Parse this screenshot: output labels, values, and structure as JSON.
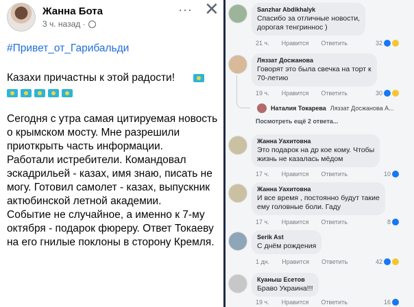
{
  "post": {
    "author": "Жанна Бота",
    "time": "3 ч. назад ·",
    "more": "···",
    "close": "✕",
    "hashtag": "#Привет_от_Гарибальди",
    "text": "Казахи причастны к этой радости!\n\n\nСегодня с утра самая цитируемая новость о крымском мосту. Мне разрешили приоткрыть часть информации.\nРаботали истребители. Командовал эскадрильей - казах, имя знаю, писать не могу. Готовил самолет - казах, выпускник актюбинской летной академии.\nСобытие не случайное, а именно к 7-му октября - подарок фюреру. Ответ Токаеву на его гнилые поклоны в сторону Кремля.",
    "flag_color": "#2cb5d9"
  },
  "comments": [
    {
      "name": "Sanzhar Abdikhalyk",
      "text": "Спасибо за отличные новости,\nдорогая тенгриннос )",
      "time": "21 ч.",
      "like": "Нравится",
      "reply": "Ответить",
      "reactions": "32"
    },
    {
      "name": "Ляззат Досжанова",
      "text": "Говорят это была свечка на торт к\n70-летию",
      "time": "19 ч.",
      "like": "Нравится",
      "reply": "Ответить",
      "reactions": "30"
    },
    {
      "name": "Жанна Уахитовна",
      "text": "Это подарок на др кое кому. Чтобы\nжизнь не казалась мёдом",
      "time": "17 ч.",
      "like": "Нравится",
      "reply": "Ответить",
      "reactions": "10"
    },
    {
      "name": "Жанна Уахитовна",
      "text": "И все время , постоянно будут такие\nему головные боли. Гаду",
      "time": "17 ч.",
      "like": "Нравится",
      "reply": "Ответить",
      "reactions": "8"
    },
    {
      "name": "Serik Ast",
      "text": "С днём рождения",
      "time": "1 дн.",
      "like": "Нравится",
      "reply": "Ответить",
      "reactions": "42"
    },
    {
      "name": "Куаныш Есетов",
      "text": "Браво Украина!!!",
      "time": "19 ч.",
      "like": "Нравится",
      "reply": "Ответить",
      "reactions": "16"
    }
  ],
  "reply": {
    "name": "Наталия Токарева",
    "text": "Ляззат Досжанова А...",
    "see_more": "Посмотреть ещё 2 ответа..."
  },
  "colors": {
    "accent": "#216fdb",
    "like": "#1877f2",
    "haha": "#f7c531"
  }
}
